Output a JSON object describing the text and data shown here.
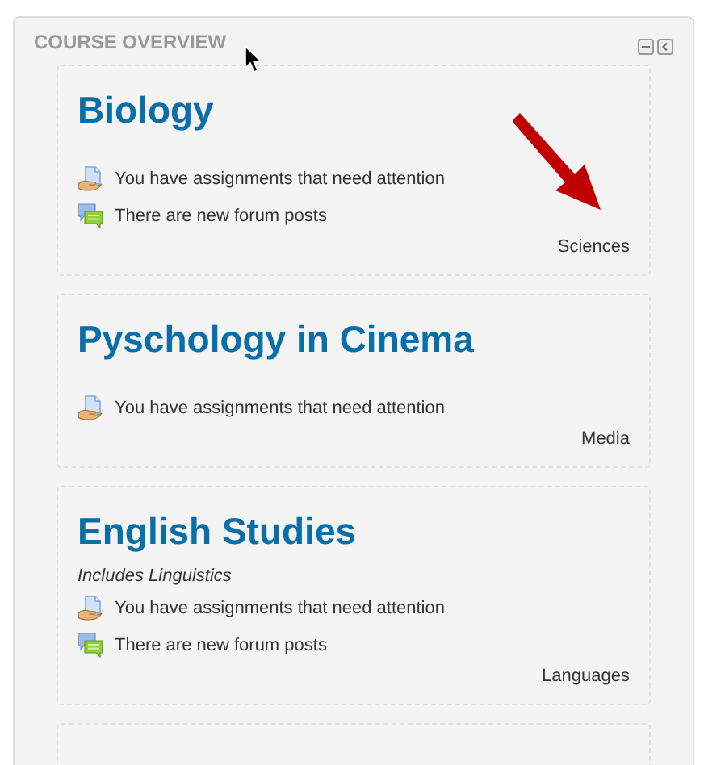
{
  "block": {
    "title": "COURSE OVERVIEW"
  },
  "courses": [
    {
      "title": "Biology",
      "notices": [
        {
          "kind": "assignment",
          "text": "You have assignments that need attention"
        },
        {
          "kind": "forum",
          "text": "There are new forum posts"
        }
      ],
      "category": "Sciences"
    },
    {
      "title": "Pyschology in Cinema",
      "notices": [
        {
          "kind": "assignment",
          "text": "You have assignments that need attention"
        }
      ],
      "category": "Media"
    },
    {
      "title": "English Studies",
      "summary": "Includes Linguistics",
      "notices": [
        {
          "kind": "assignment",
          "text": "You have assignments that need attention"
        },
        {
          "kind": "forum",
          "text": "There are new forum posts"
        }
      ],
      "category": "Languages"
    }
  ]
}
